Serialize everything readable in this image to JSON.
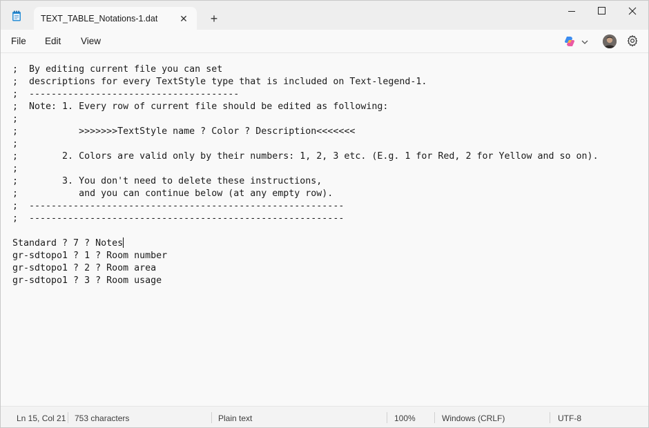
{
  "tab": {
    "title": "TEXT_TABLE_Notations-1.dat",
    "close_glyph": "✕",
    "new_tab_glyph": "+"
  },
  "menu": {
    "file": "File",
    "edit": "Edit",
    "view": "View"
  },
  "icons": {
    "app": "notepad-icon",
    "copilot": "copilot-icon",
    "profile": "avatar",
    "settings": "gear-icon"
  },
  "editor": {
    "lines": [
      ";  By editing current file you can set",
      ";  descriptions for every TextStyle type that is included on Text-legend-1.",
      ";  --------------------------------------",
      ";  Note: 1. Every row of current file should be edited as following:",
      ";",
      ";           >>>>>>>TextStyle name ? Color ? Description<<<<<<<",
      ";",
      ";        2. Colors are valid only by their numbers: 1, 2, 3 etc. (E.g. 1 for Red, 2 for Yellow and so on).",
      ";",
      ";        3. You don't need to delete these instructions,",
      ";           and you can continue below (at any empty row).",
      ";  ---------------------------------------------------------",
      ";  ---------------------------------------------------------",
      "",
      "Standard ? 7 ? Notes",
      "gr-sdtopo1 ? 1 ? Room number",
      "gr-sdtopo1 ? 2 ? Room area",
      "gr-sdtopo1 ? 3 ? Room usage"
    ]
  },
  "status": {
    "position": "Ln 15, Col 21",
    "characters": "753 characters",
    "format": "Plain text",
    "zoom": "100%",
    "line_ending": "Windows (CRLF)",
    "encoding": "UTF-8"
  },
  "colors": {
    "copilot_accent": "#6b5cff",
    "title_bar": "#eeeeee",
    "editor_bg": "#f9f9f9"
  }
}
